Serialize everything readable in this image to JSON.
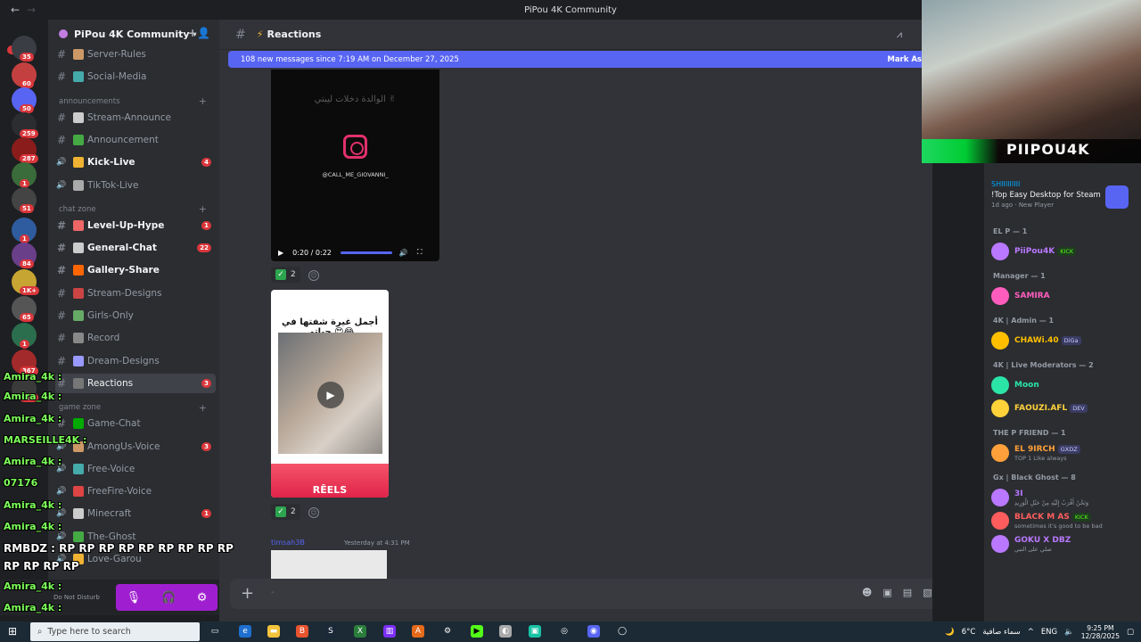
{
  "window": {
    "title": "PiPou 4K Community"
  },
  "rail": {
    "new_label": "NEW",
    "badges": [
      "35",
      "60",
      "50",
      "259",
      "287",
      "1",
      "51",
      "1",
      "84",
      "1K+",
      "65",
      "1",
      "367",
      "239"
    ]
  },
  "server": {
    "name": "PiPou 4K Community"
  },
  "channels": [
    {
      "label": "Server-Rules",
      "state": "normal"
    },
    {
      "label": "Social-Media",
      "state": "normal"
    },
    {
      "label": "announcements",
      "type": "category"
    },
    {
      "label": "Stream-Announce",
      "state": "normal"
    },
    {
      "label": "Announcement",
      "state": "normal"
    },
    {
      "label": "Kick-Live",
      "state": "unread",
      "count": "4"
    },
    {
      "label": "TikTok-Live",
      "state": "normal"
    },
    {
      "label": "chat zone",
      "type": "category"
    },
    {
      "label": "Level-Up-Hype",
      "state": "unread",
      "count": "1"
    },
    {
      "label": "General-Chat",
      "state": "unread",
      "count": "22"
    },
    {
      "label": "Gallery-Share",
      "state": "unread"
    },
    {
      "label": "Stream-Designs",
      "state": "normal"
    },
    {
      "label": "Girls-Only",
      "state": "normal"
    },
    {
      "label": "Record",
      "state": "normal"
    },
    {
      "label": "Dream-Designs",
      "state": "normal"
    },
    {
      "label": "Reactions",
      "state": "active",
      "count": "3"
    },
    {
      "label": "game zone",
      "type": "category"
    },
    {
      "label": "Game-Chat",
      "state": "normal"
    },
    {
      "label": "AmongUs-Voice",
      "state": "normal",
      "count": "3"
    },
    {
      "label": "Free-Voice",
      "state": "normal"
    },
    {
      "label": "FreeFire-Voice",
      "state": "normal"
    },
    {
      "label": "Minecraft",
      "state": "normal",
      "count": "1"
    },
    {
      "label": "The-Ghost",
      "state": "normal"
    },
    {
      "label": "Love-Garou",
      "state": "normal"
    }
  ],
  "main": {
    "channel_name": "Reactions",
    "new_messages": "108 new messages since 7:19 AM on December 27, 2025",
    "mark_as_read": "Mark As",
    "video": {
      "arabic_text": "الوالدة دخلات ليبتي ✌",
      "handle": "@CALL_ME_GIOVANNI_",
      "time": "0:20 / 0:22"
    },
    "reactions_1": {
      "count": "2"
    },
    "reel": {
      "title": "أجمل غيرة شفتها في حياتي 😍😂",
      "label": "RÊELS"
    },
    "reactions_2": {
      "count": "2"
    },
    "next_author": "timsah3B",
    "next_time": "Yesterday at 4:31 PM",
    "composer_placeholder": "-"
  },
  "webcam": {
    "name": "PIIPOU4K"
  },
  "members": {
    "game_title": "SHIIIIIIIII",
    "game_name": "!Top Easy Desktop for Steam",
    "game_meta": "1d ago · New Player",
    "groups": [
      {
        "role": "EL P — 1",
        "members": [
          {
            "name": "PiiPou4K",
            "tag": "KICK",
            "color": "#b978ff"
          }
        ]
      },
      {
        "role": "Manager — 1",
        "members": [
          {
            "name": "SAMIRA",
            "color": "#ff5dbe"
          }
        ]
      },
      {
        "role": "4K | Admin — 1",
        "members": [
          {
            "name": "CHAWi.40",
            "tag": "DiGa",
            "color": "#ffbf00"
          }
        ]
      },
      {
        "role": "4K | Live Moderators — 2",
        "members": [
          {
            "name": "Moon",
            "color": "#2be5a7"
          },
          {
            "name": "FAOUZI.AFL",
            "tag": "DEV",
            "color": "#ffd23a"
          }
        ]
      },
      {
        "role": "THE P FRIEND — 1",
        "members": [
          {
            "name": "EL 9IRCH",
            "tag": "GXDZ",
            "sub": "TOP 1 Like always",
            "color": "#ffa03a"
          }
        ]
      },
      {
        "role": "Gx | Black Ghost — 8",
        "members": [
          {
            "name": "3I",
            "sub": "وَنَحْنُ أَقْرَبُ إِلَيْهِ مِنْ حَبْلِ الْوَرِيدِ",
            "color": "#b978ff"
          },
          {
            "name": "BLACK M AS",
            "tag": "KICK",
            "sub": "sometimes it's good to be bad",
            "color": "#ff5d5d"
          },
          {
            "name": "GOKU X DBZ",
            "sub": "صلي على النبي",
            "color": "#b978ff"
          }
        ]
      }
    ]
  },
  "overlay": {
    "lines": [
      {
        "text": "Amira_4k :",
        "kind": "green"
      },
      {
        "text": "Amira_4k :",
        "kind": "green"
      },
      {
        "text": "Amira_4k :",
        "kind": "green"
      },
      {
        "text": "MARSEILLE4K :",
        "kind": "green"
      },
      {
        "text": "Amira_4k :",
        "kind": "green"
      },
      {
        "text": "07176",
        "kind": "green"
      },
      {
        "text": "Amira_4k :",
        "kind": "green"
      },
      {
        "text": "Amira_4k :",
        "kind": "green"
      },
      {
        "text": "RMBDZ : RP RP RP RP RP RP RP RP RP",
        "kind": "rp"
      },
      {
        "text": "RP RP RP RP",
        "kind": "rp"
      },
      {
        "text": "Amira_4k :",
        "kind": "green"
      },
      {
        "text": "Amira_4k :",
        "kind": "green"
      }
    ],
    "dnd_label": "Do Not Disturb"
  },
  "taskbar": {
    "search_placeholder": "Type here to search",
    "weather": "6°C",
    "weather_text": "سماء صافية",
    "lang": "ENG",
    "time": "9:25 PM",
    "date": "12/28/2025"
  },
  "colors": {
    "blurple": "#5865f2",
    "red": "#da373c",
    "purple_bar": "#9f1fd0"
  }
}
